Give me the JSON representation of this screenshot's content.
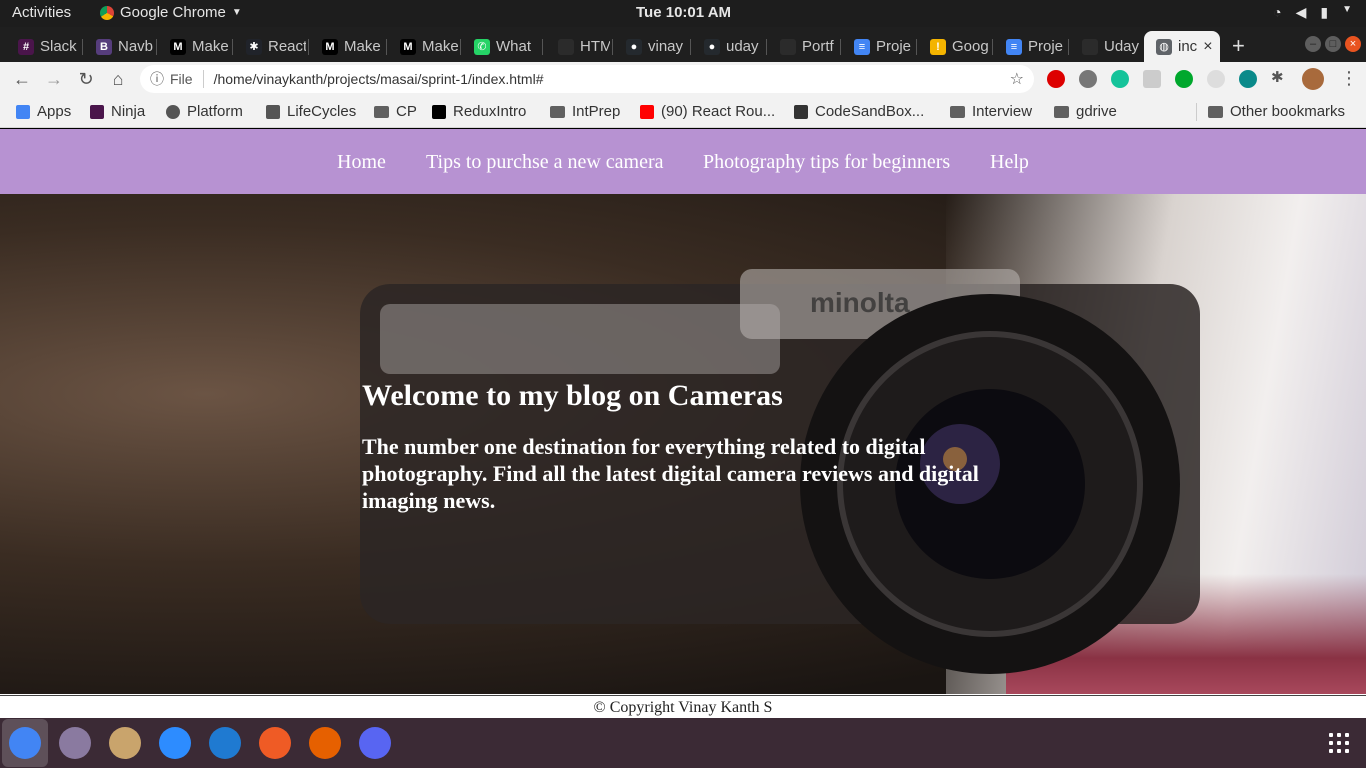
{
  "system_bar": {
    "activities": "Activities",
    "app_name": "Google Chrome",
    "clock": "Tue 10:01 AM"
  },
  "tabs": [
    {
      "label": "Slack",
      "icon": "slack-icon",
      "color": "#4a154b"
    },
    {
      "label": "Navb",
      "icon": "bootstrap-icon",
      "color": "#563d7c"
    },
    {
      "label": "Make",
      "icon": "medium-icon",
      "color": "#000000"
    },
    {
      "label": "React",
      "icon": "react-icon",
      "color": "#20232a"
    },
    {
      "label": "Make",
      "icon": "medium-icon",
      "color": "#000000"
    },
    {
      "label": "Make",
      "icon": "medium-icon",
      "color": "#000000"
    },
    {
      "label": "What",
      "icon": "whatsapp-icon",
      "color": "#25d366"
    },
    {
      "label": "HTML",
      "icon": "generic-page-icon",
      "color": "#2b2b2b"
    },
    {
      "label": "vinay",
      "icon": "github-icon",
      "color": "#24292e"
    },
    {
      "label": "uday",
      "icon": "github-icon",
      "color": "#24292e"
    },
    {
      "label": "Portf",
      "icon": "generic-page-icon",
      "color": "#2b2b2b"
    },
    {
      "label": "Proje",
      "icon": "google-docs-icon",
      "color": "#4285f4"
    },
    {
      "label": "Goog",
      "icon": "google-keep-icon",
      "color": "#f4b400"
    },
    {
      "label": "Proje",
      "icon": "google-docs-icon",
      "color": "#4285f4"
    },
    {
      "label": "Uday",
      "icon": "generic-page-icon",
      "color": "#2b2b2b"
    },
    {
      "label": "inc",
      "icon": "globe-icon",
      "color": "#5f6368",
      "active": true
    }
  ],
  "address_bar": {
    "scheme_label": "File",
    "url": "/home/vinaykanth/projects/masai/sprint-1/index.html#"
  },
  "bookmarks": [
    {
      "label": "Apps",
      "icon": "apps-grid-icon"
    },
    {
      "label": "Ninja",
      "icon": "slack-icon"
    },
    {
      "label": "Platform",
      "icon": "globe-icon"
    },
    {
      "label": "LifeCycles",
      "icon": "book-icon"
    },
    {
      "label": "CP",
      "icon": "folder-icon"
    },
    {
      "label": "ReduxIntro",
      "icon": "medium-icon"
    },
    {
      "label": "IntPrep",
      "icon": "folder-icon"
    },
    {
      "label": "(90) React Rou...",
      "icon": "youtube-icon"
    },
    {
      "label": "CodeSandBox...",
      "icon": "codesandbox-icon"
    },
    {
      "label": "Interview",
      "icon": "folder-icon"
    },
    {
      "label": "gdrive",
      "icon": "folder-icon"
    },
    {
      "label": "Other bookmarks",
      "icon": "folder-icon"
    }
  ],
  "site": {
    "nav": [
      "Home",
      "Tips to purchse a new camera",
      "Photography tips for beginners",
      "Help"
    ],
    "hero_title": "Welcome to my blog on Cameras",
    "hero_subtitle": "The number one destination for everything related to digital photography. Find all the latest digital camera reviews and digital imaging news.",
    "footer": "© Copyright Vinay Kanth S",
    "nav_color": "#b792d2"
  },
  "dock": [
    {
      "name": "chrome-icon",
      "color": "#4285f4",
      "active": true
    },
    {
      "name": "screenshot-tool-icon",
      "color": "#8a7aa0"
    },
    {
      "name": "file-manager-icon",
      "color": "#c9a46c"
    },
    {
      "name": "zoom-icon",
      "color": "#2d8cff"
    },
    {
      "name": "vscode-icon",
      "color": "#1f7ad1"
    },
    {
      "name": "postman-icon",
      "color": "#ef5b25"
    },
    {
      "name": "firefox-icon",
      "color": "#e66000"
    },
    {
      "name": "discord-icon",
      "color": "#5865f2"
    }
  ]
}
